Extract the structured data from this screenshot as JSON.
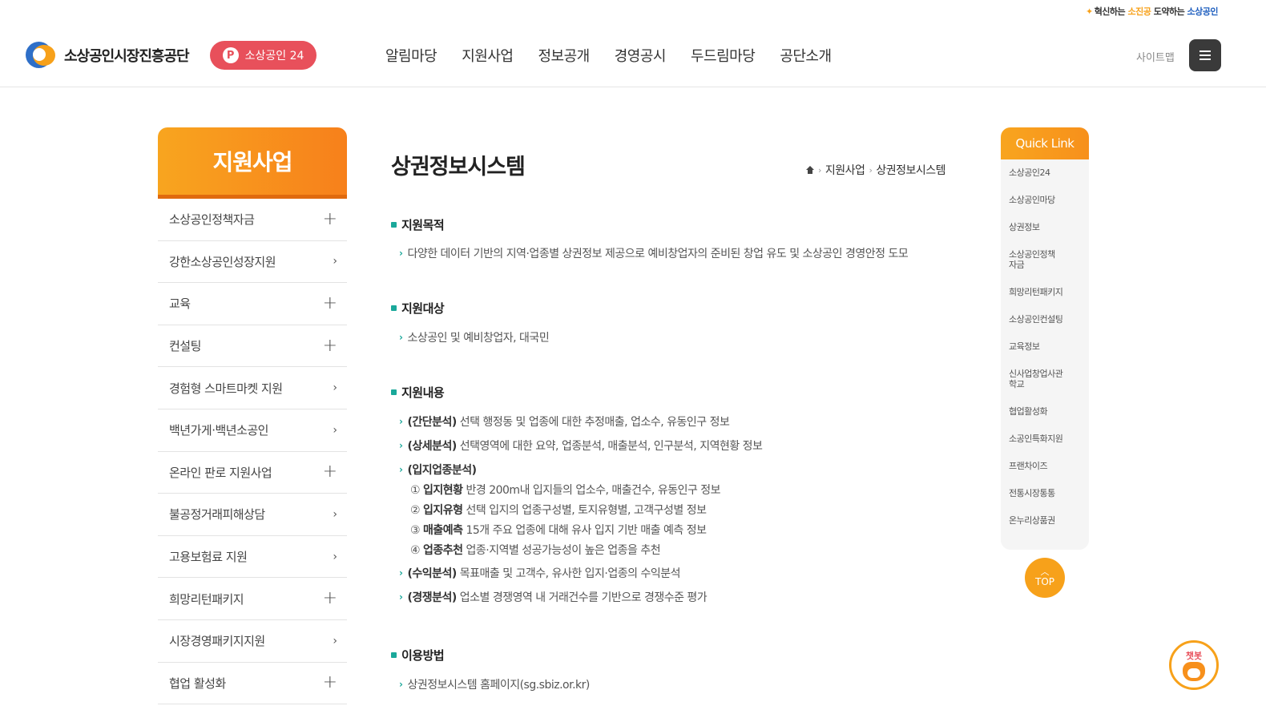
{
  "slogan": {
    "prefix": "혁신하는 ",
    "hl1": "소진공",
    "mid": " 도약하는 ",
    "hl2": "소상공인"
  },
  "header": {
    "logo_text": "소상공인시장진흥공단",
    "pill_icon": "P",
    "pill_label": "소상공인 24",
    "nav": [
      "알림마당",
      "지원사업",
      "정보공개",
      "경영공시",
      "두드림마당",
      "공단소개"
    ],
    "sitemap": "사이트맵"
  },
  "sidebar": {
    "title": "지원사업",
    "items": [
      {
        "label": "소상공인정책자금",
        "icon": "plus-icon"
      },
      {
        "label": "강한소상공인성장지원",
        "icon": "chevron-right-icon"
      },
      {
        "label": "교육",
        "icon": "plus-icon"
      },
      {
        "label": "컨설팅",
        "icon": "plus-icon"
      },
      {
        "label": "경험형 스마트마켓 지원",
        "icon": "chevron-right-icon"
      },
      {
        "label": "백년가게·백년소공인",
        "icon": "chevron-right-icon"
      },
      {
        "label": "온라인 판로 지원사업",
        "icon": "plus-icon"
      },
      {
        "label": "불공정거래피해상담",
        "icon": "chevron-right-icon"
      },
      {
        "label": "고용보험료 지원",
        "icon": "chevron-right-icon"
      },
      {
        "label": "희망리턴패키지",
        "icon": "plus-icon"
      },
      {
        "label": "시장경영패키지지원",
        "icon": "chevron-right-icon"
      },
      {
        "label": "협업 활성화",
        "icon": "plus-icon"
      }
    ]
  },
  "content": {
    "title": "상권정보시스템",
    "breadcrumb": [
      "지원사업",
      "상권정보시스템"
    ],
    "sections": {
      "purpose": {
        "title": "지원목적",
        "items": [
          "다양한 데이터 기반의 지역·업종별 상권정보 제공으로 예비창업자의 준비된 창업 유도 및 소상공인 경영안정 도모"
        ]
      },
      "target": {
        "title": "지원대상",
        "items": [
          "소상공인 및 예비창업자, 대국민"
        ]
      },
      "contents": {
        "title": "지원내용",
        "items": [
          {
            "bold": "(간단분석)",
            "text": " 선택 행정동 및 업종에 대한 추정매출, 업소수, 유동인구 정보"
          },
          {
            "bold": "(상세분석)",
            "text": " 선택영역에 대한 요약, 업종분석, 매출분석, 인구분석, 지역현황 정보"
          },
          {
            "bold": "(입지업종분석)",
            "text": ""
          }
        ],
        "sub_items": [
          {
            "num": "①",
            "bold": "입지현황",
            "text": " 반경 200m내 입지들의 업소수, 매출건수, 유동인구 정보"
          },
          {
            "num": "②",
            "bold": "입지유형",
            "text": " 선택 입지의 업종구성별, 토지유형별, 고객구성별 정보"
          },
          {
            "num": "③",
            "bold": "매출예측",
            "text": " 15개 주요 업종에 대해 유사 입지 기반 매출 예측 정보"
          },
          {
            "num": "④",
            "bold": "업종추천",
            "text": " 업종·지역별 성공가능성이 높은 업종을 추천"
          }
        ],
        "items_after": [
          {
            "bold": "(수익분석)",
            "text": " 목표매출 및 고객수, 유사한 입지·업종의 수익분석"
          },
          {
            "bold": "(경쟁분석)",
            "text": " 업소별 경쟁영역 내 거래건수를 기반으로 경쟁수준 평가"
          }
        ]
      },
      "usage": {
        "title": "이용방법",
        "items": [
          "상권정보시스템 홈페이지(sg.sbiz.or.kr)"
        ]
      }
    }
  },
  "quick_link": {
    "title": "Quick Link",
    "items": [
      "소상공인24",
      "소상공인마당",
      "상권정보",
      "소상공인정책\n자금",
      "희망리턴패키지",
      "소상공인컨설팅",
      "교육정보",
      "신사업창업사관\n학교",
      "협업활성화",
      "소공인특화지원",
      "프랜차이즈",
      "전통시장통통",
      "온누리상품권"
    ]
  },
  "top_button": "TOP",
  "chatbot_label": "챗봇"
}
